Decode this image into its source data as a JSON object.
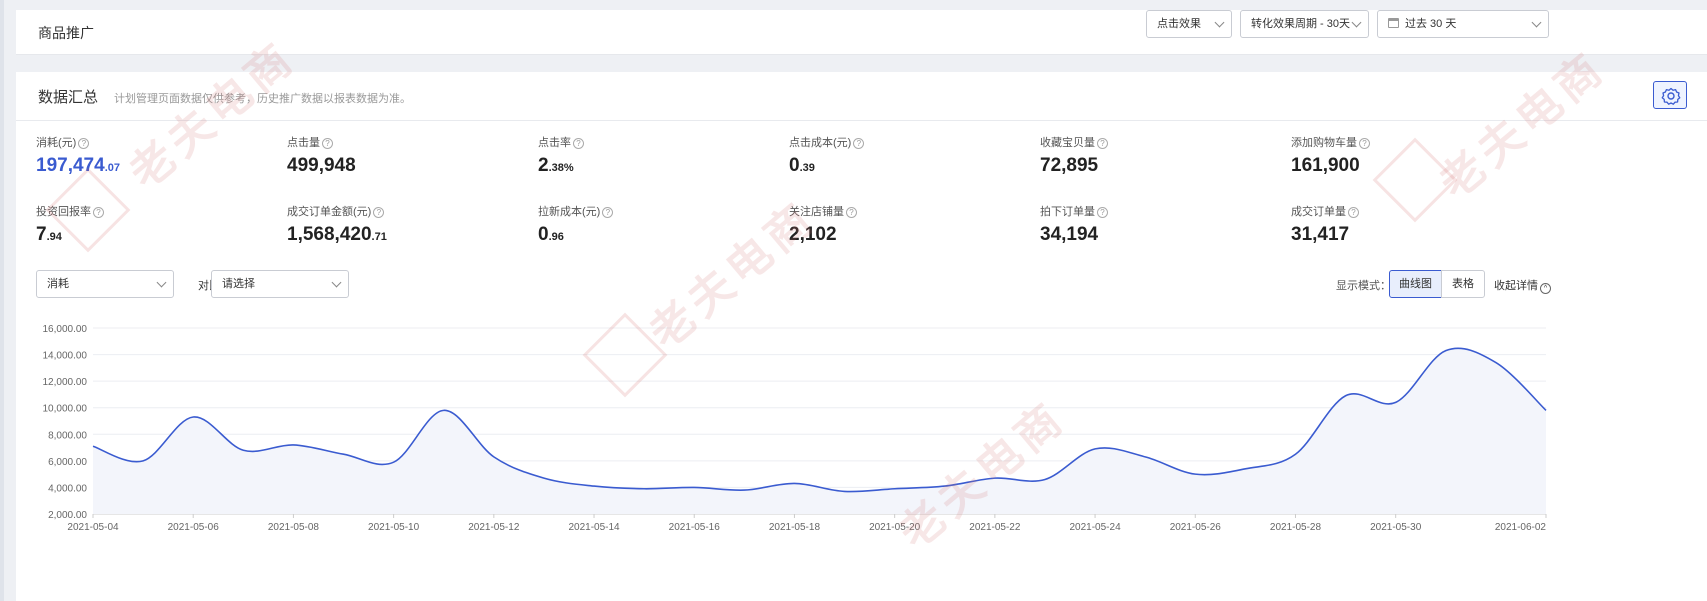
{
  "header": {
    "title": "商品推广",
    "filter_effect": "点击效果",
    "filter_period": "转化效果周期 - 30天",
    "filter_range": "过去 30 天"
  },
  "summary": {
    "title": "数据汇总",
    "note": "计划管理页面数据仅供参考，历史推广数据以报表数据为准。",
    "metrics": [
      {
        "label": "消耗(元)",
        "int": "197,474",
        "dec": ".07",
        "accent": true
      },
      {
        "label": "点击量",
        "int": "499,948",
        "dec": ""
      },
      {
        "label": "点击率",
        "int": "2",
        "dec": ".38%"
      },
      {
        "label": "点击成本(元)",
        "int": "0",
        "dec": ".39"
      },
      {
        "label": "收藏宝贝量",
        "int": "72,895",
        "dec": ""
      },
      {
        "label": "添加购物车量",
        "int": "161,900",
        "dec": ""
      },
      {
        "label": "投资回报率",
        "int": "7",
        "dec": ".94"
      },
      {
        "label": "成交订单金额(元)",
        "int": "1,568,420",
        "dec": ".71"
      },
      {
        "label": "拉新成本(元)",
        "int": "0",
        "dec": ".96"
      },
      {
        "label": "关注店铺量",
        "int": "2,102",
        "dec": ""
      },
      {
        "label": "拍下订单量",
        "int": "34,194",
        "dec": ""
      },
      {
        "label": "成交订单量",
        "int": "31,417",
        "dec": ""
      }
    ]
  },
  "controls": {
    "metric_select": "消耗",
    "compare_label": "对比",
    "compare_select": "请选择",
    "mode_label": "显示模式：",
    "mode_curve": "曲线图",
    "mode_table": "表格",
    "collapse": "收起详情"
  },
  "watermark": "老夫电商",
  "colors": {
    "accent": "#3a5bd0",
    "line": "#3a5bd0",
    "area": "#f3f5fb"
  },
  "chart_data": {
    "type": "area",
    "x": [
      "2021-05-04",
      "2021-05-05",
      "2021-05-06",
      "2021-05-07",
      "2021-05-08",
      "2021-05-09",
      "2021-05-10",
      "2021-05-11",
      "2021-05-12",
      "2021-05-13",
      "2021-05-14",
      "2021-05-15",
      "2021-05-16",
      "2021-05-17",
      "2021-05-18",
      "2021-05-19",
      "2021-05-20",
      "2021-05-21",
      "2021-05-22",
      "2021-05-23",
      "2021-05-24",
      "2021-05-25",
      "2021-05-26",
      "2021-05-27",
      "2021-05-28",
      "2021-05-29",
      "2021-05-30",
      "2021-05-31",
      "2021-06-01",
      "2021-06-02"
    ],
    "x_tick_labels": [
      "2021-05-04",
      "2021-05-06",
      "2021-05-08",
      "2021-05-10",
      "2021-05-12",
      "2021-05-14",
      "2021-05-16",
      "2021-05-18",
      "2021-05-20",
      "2021-05-22",
      "2021-05-24",
      "2021-05-26",
      "2021-05-28",
      "2021-05-30",
      "2021-06-02"
    ],
    "series": [
      {
        "values": [
          7100,
          6000,
          9300,
          6800,
          7200,
          6500,
          5900,
          9800,
          6300,
          4700,
          4100,
          3900,
          4000,
          3800,
          4300,
          3700,
          3900,
          4100,
          4700,
          4600,
          6900,
          6300,
          5000,
          5400,
          6500,
          10900,
          10400,
          14300,
          13400,
          9800
        ]
      }
    ],
    "ylim": [
      2000,
      16000
    ],
    "y_ticks": [
      "16,000.00",
      "14,000.00",
      "12,000.00",
      "10,000.00",
      "8,000.00",
      "6,000.00",
      "4,000.00",
      "2,000.00"
    ],
    "grid": true
  }
}
